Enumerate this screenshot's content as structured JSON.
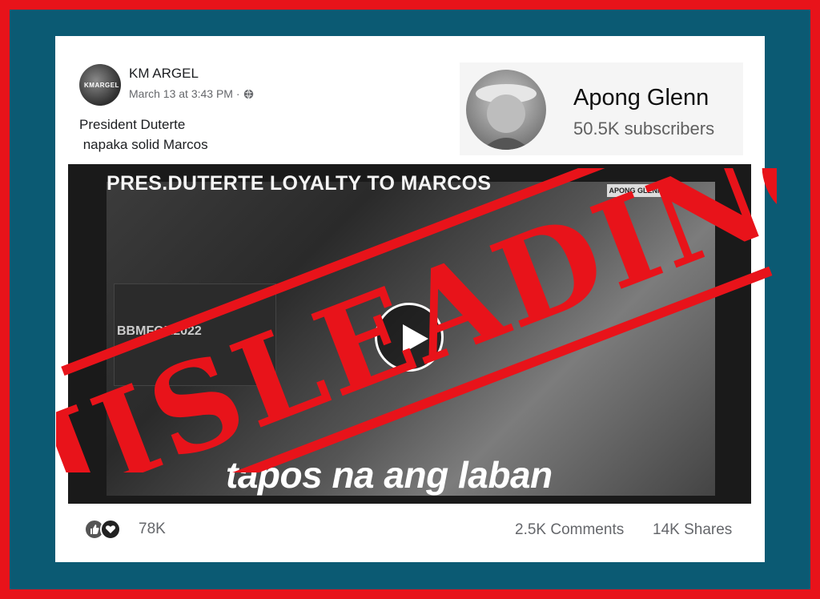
{
  "post": {
    "author": "KM ARGEL",
    "avatar_text": "KMARGEL",
    "timestamp": "March 13 at 3:43 PM ·",
    "caption": "President Duterte\n napaka solid Marcos"
  },
  "channel": {
    "name": "Apong Glenn",
    "subscribers": "50.5K subscribers"
  },
  "video": {
    "title": "PRES.DUTERTE LOYALTY TO MARCOS",
    "badge": "APONG GLENN",
    "inset_text": "BBMFOR2022",
    "subtitle": "tapos na ang laban"
  },
  "stamp": {
    "label": "MISLEADING",
    "color": "#e8131a"
  },
  "engagement": {
    "reactions": "78K",
    "comments": "2.5K Comments",
    "shares": "14K Shares"
  },
  "colors": {
    "outer_border": "#e8131a",
    "inner_frame": "#0b5a73"
  }
}
